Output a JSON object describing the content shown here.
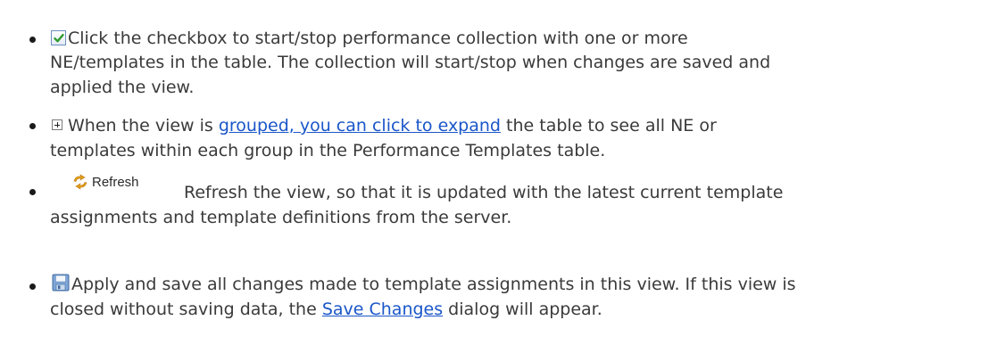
{
  "items": [
    {
      "icon": "checkbox-checked-icon",
      "lines": [
        "Click the checkbox to start/stop performance collection with one or more",
        "NE/templates in the table. The collection will start/stop when changes are saved and",
        "applied the view."
      ]
    },
    {
      "icon": "expand-plus-icon",
      "line1_before": "When the view is ",
      "line1_link": "grouped, you can click to expand",
      "line1_after": " the table to see all NE or",
      "line2": "templates within each group in the Performance Templates table."
    },
    {
      "icon": "refresh-icon",
      "button_label": "Refresh",
      "lines": [
        "Refresh the view, so that it is updated with the latest current template",
        "assignments and template definitions from the server."
      ]
    },
    {
      "icon": "save-floppy-icon",
      "line1": "Apply and save all changes made to template assignments in this view. If this view is",
      "line2_before": "closed without saving data, the ",
      "line2_link": "Save Changes",
      "line2_after": " dialog will appear."
    }
  ]
}
